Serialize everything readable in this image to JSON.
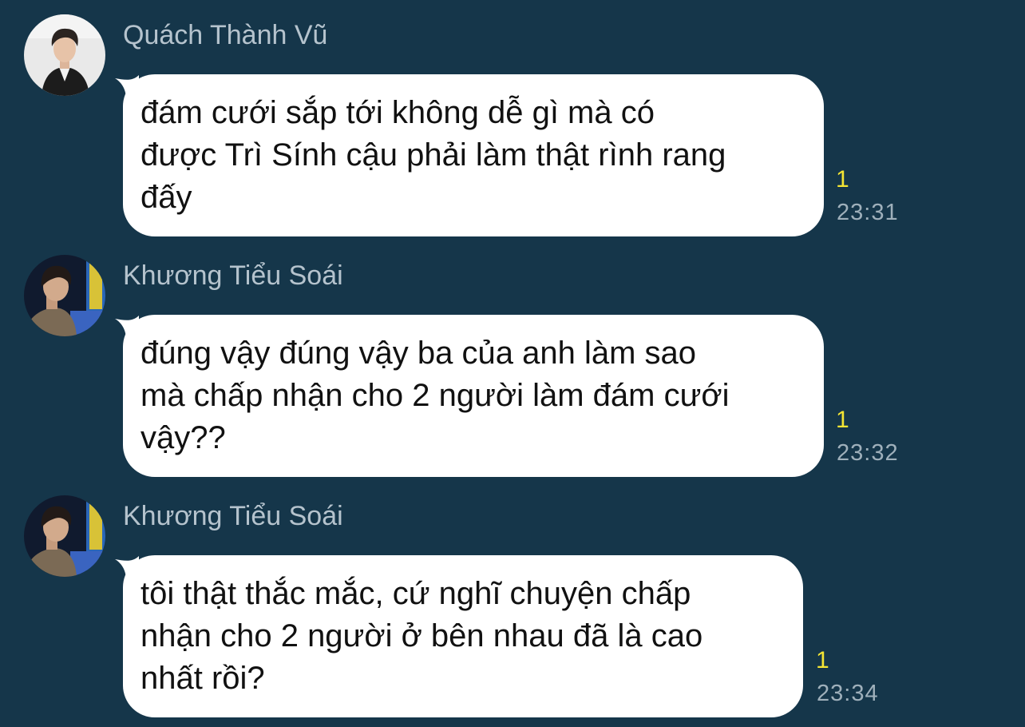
{
  "colors": {
    "background": "#15364a",
    "bubble": "#ffffff",
    "message_text": "#111111",
    "sender_name": "#b5c3cd",
    "unread_count": "#f4e533",
    "timestamp": "#9fb0bb"
  },
  "messages": [
    {
      "sender": "Quách Thành Vũ",
      "avatar_icon": "profile-photo",
      "lines": [
        "đám cưới sắp tới không dễ gì mà có",
        "được Trì Sính cậu phải làm thật rình rang",
        "đấy"
      ],
      "unread_count": "1",
      "time": "23:31"
    },
    {
      "sender": "Khương Tiểu Soái",
      "avatar_icon": "profile-photo",
      "lines": [
        "đúng vậy đúng vậy ba của anh làm sao",
        "mà chấp nhận cho 2 người làm đám cưới",
        "vậy??"
      ],
      "unread_count": "1",
      "time": "23:32"
    },
    {
      "sender": "Khương Tiểu Soái",
      "avatar_icon": "profile-photo",
      "lines": [
        "tôi thật thắc mắc, cứ nghĩ chuyện chấp",
        "nhận cho 2 người ở bên nhau đã là cao",
        "nhất rồi?"
      ],
      "unread_count": "1",
      "time": "23:34"
    }
  ]
}
